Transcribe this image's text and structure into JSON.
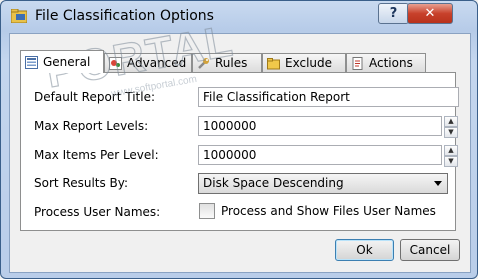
{
  "window": {
    "title": "File Classification Options",
    "help_label": "?",
    "close_label": "✕"
  },
  "tabs": [
    {
      "label": "General",
      "icon": "list-icon"
    },
    {
      "label": "Advanced",
      "icon": "settings-icon"
    },
    {
      "label": "Rules",
      "icon": "wrench-icon"
    },
    {
      "label": "Exclude",
      "icon": "folder-icon"
    },
    {
      "label": "Actions",
      "icon": "document-icon"
    }
  ],
  "form": {
    "default_report_title": {
      "label": "Default Report Title:",
      "value": "File Classification Report"
    },
    "max_report_levels": {
      "label": "Max Report Levels:",
      "value": "1000000"
    },
    "max_items_per_level": {
      "label": "Max Items Per Level:",
      "value": "1000000"
    },
    "sort_results_by": {
      "label": "Sort Results By:",
      "value": "Disk Space Descending"
    },
    "process_user_names": {
      "label": "Process User Names:",
      "checkbox_label": "Process and Show Files User Names",
      "checked": false
    }
  },
  "buttons": {
    "ok": "Ok",
    "cancel": "Cancel"
  },
  "watermark": {
    "brand": "PORTAL",
    "url": "www.softportal.com"
  }
}
